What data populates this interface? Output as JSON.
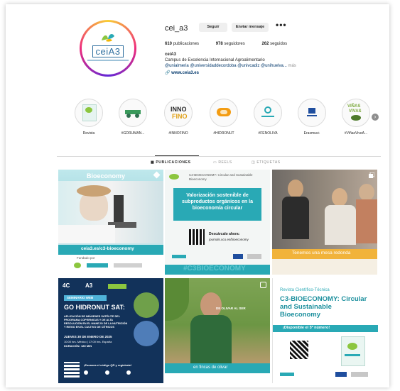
{
  "profile": {
    "username": "cei_a3",
    "follow_label": "Seguir",
    "message_label": "Enviar mensaje",
    "more_label": "•••",
    "logo_text": "ceiA3",
    "stats": [
      {
        "count": "610",
        "label": "publicaciones"
      },
      {
        "count": "978",
        "label": "seguidores"
      },
      {
        "count": "262",
        "label": "seguidos"
      }
    ],
    "bio_name": "ceiA3",
    "bio_line1": "Campus de Excelencia Internacional Agroalimentario",
    "bio_tags": "@unialmeria @universidaddecordoba @univcadiz @unihuelva...",
    "bio_more": "más",
    "bio_link": "www.ceia3.es"
  },
  "highlights": [
    {
      "label": "Revista",
      "icon": "bioeconomy-cover-icon"
    },
    {
      "label": "#GDRUMAN...",
      "icon": "tractor-icon"
    },
    {
      "label": "#INNOFINO",
      "icon": "innofino-icon"
    },
    {
      "label": "#HIDRONUT",
      "icon": "hidronut-icon"
    },
    {
      "label": "#FENOLIVA",
      "icon": "fenoliva-icon"
    },
    {
      "label": "Erasmus+",
      "icon": "eu-flag-icon"
    },
    {
      "label": "#ViñasViveA...",
      "icon": "vinas-vivas-icon"
    }
  ],
  "tabs": [
    {
      "label": "PUBLICACIONES",
      "icon": "grid-icon"
    },
    {
      "label": "REELS",
      "icon": "reels-icon"
    },
    {
      "label": "ETIQUETAS",
      "icon": "tag-icon"
    }
  ],
  "posts": {
    "p1": {
      "title": "Bioeconomy",
      "url": "ceia3.es/c3-bioeconomy",
      "footer": "Fundado por"
    },
    "p2": {
      "header": "C3-BIOECONOMY: Circular and Sustainable Bioeconomy",
      "headline": "Valorización sostenible de subproductos orgánicos en la bioeconomía circular",
      "qr_label": "Descárcalo ahora:",
      "qr_url": "journals.uco.es/bioeconomy",
      "bottom": "#C3BIOECONOMY"
    },
    "p3": {
      "caption": "Tenemos una mesa redonda"
    },
    "p4": {
      "badge": "SEMINARIO WEB",
      "title": "GO HIDRONUT SAT:",
      "desc": "APLICACIÓN DE IMÁGENES SATÉLITE DEL PROGRAMA COPERNICUS Y DE ALTA RESOLUCIÓN EN EL MANEJO DE LA NUTRICIÓN Y RIEGO EN EL CULTIVO DE CÍTRICOS",
      "date": "JUEVES 30 DE ENERO DE 2025",
      "time": "10:00 hrs. México | 17:00 hrs. España",
      "duration": "DURACIÓN: 180 MIN",
      "cta": "¡Escanea el código QR y regístrate!"
    },
    "p5": {
      "caption": "en fincas de olivar",
      "overlay": "DE OLIVAR AL SER"
    },
    "p6": {
      "kicker": "Revista Científico-Técnica",
      "title": "C3-BIOECONOMY: Circular and Sustainable Bioeconomy",
      "banner": "¡Disponible el 5º número!"
    }
  },
  "colors": {
    "accent_teal": "#29a9b5",
    "link_blue": "#00376b",
    "navy": "#12325a"
  }
}
